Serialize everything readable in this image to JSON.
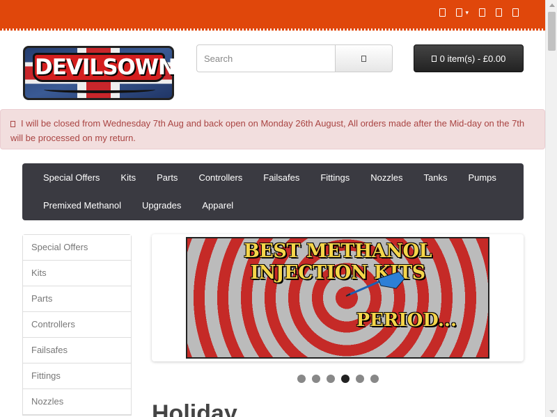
{
  "topbar": {
    "bg_color": "#e0470b",
    "icons": [
      "phone-icon",
      "user-icon",
      "heart-icon",
      "cart-icon",
      "share-icon"
    ]
  },
  "logo": {
    "text": "DEVILSOWN"
  },
  "search": {
    "placeholder": "Search",
    "button_icon": "search-icon"
  },
  "cart": {
    "label": "0 item(s) - £0.00",
    "icon": "cart-icon"
  },
  "alert": {
    "icon": "info-icon",
    "text": "I will be closed from Wednesday 7th Aug and back open on Monday 26th August, All orders made after the Mid-day on the 7th will be processed on my return."
  },
  "nav": {
    "items": [
      "Special Offers",
      "Kits",
      "Parts",
      "Controllers",
      "Failsafes",
      "Fittings",
      "Nozzles",
      "Tanks",
      "Pumps",
      "Premixed Methanol",
      "Upgrades",
      "Apparel"
    ]
  },
  "sidebar": {
    "items": [
      "Special Offers",
      "Kits",
      "Parts",
      "Controllers",
      "Failsafes",
      "Fittings",
      "Nozzles"
    ]
  },
  "banner": {
    "title": "BEST METHANOL INJECTION KITS",
    "subtitle": "PERIOD..."
  },
  "carousel": {
    "slide_count": 6,
    "active_index": 4
  },
  "main": {
    "heading": "Holiday"
  }
}
